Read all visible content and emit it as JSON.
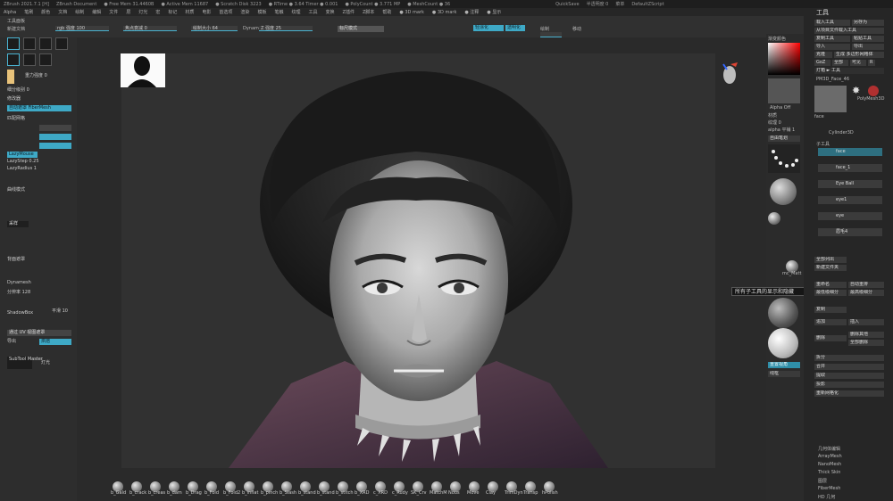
{
  "title_bar": {
    "items": [
      "ZBrush 2021.7.1 [H]",
      "ZBrush Document",
      "● Free Mem 31.4460B",
      "● Active Mem 11687",
      "● Scratch Disk 3223",
      "● RTime ● 3.64 Timer ● 0.001",
      "● PolyCount ● 3.771 MP",
      "● MeshCount ● 36"
    ],
    "quicksave": "QuickSave",
    "transparency": "半透明度 0",
    "menu_label": "菜单",
    "script": "DefaultZScript"
  },
  "menu": [
    "Alpha",
    "笔刷",
    "颜色",
    "文档",
    "绘制",
    "编辑",
    "文件",
    "层",
    "灯光",
    "宏",
    "标记",
    "材质",
    "电影",
    "首选项",
    "渲染",
    "模板",
    "笔触",
    "纹理",
    "工具",
    "变换",
    "Z插件",
    "Z脚本",
    "帮助",
    "● 3D mark",
    "● 3D mark",
    "● 注释",
    "● 显示"
  ],
  "tool_title": "工具",
  "top_shelf": {
    "tool_palette": "工具面板",
    "new_doc": "新建文档",
    "rgb_strength": "rgb 强度 100",
    "z_strength": "Z 强度 25",
    "draw_size": "绘制大小 64",
    "focal": "焦点衰减 0",
    "zadd": "Zadd",
    "zsub": "Zsub",
    "mrgb": "Mrgb",
    "rgb": "Rgb",
    "m": "M",
    "dynamic": "Dynamic",
    "ruler": "标尺模式",
    "btn_a": "轻涂化",
    "btn_b": "透明化",
    "draw": "绘制",
    "move": "移动",
    "scale": "缩放",
    "rotate": "旋转",
    "stroke": "自由笔划",
    "spotlight": "投影球",
    "perspective": "透视",
    "local": "轴",
    "grid": "平移视图"
  },
  "left_panel": {
    "lines": [
      "重力强度 0",
      "细分级别 0",
      "修改器",
      "匹配网格",
      "曲线模式",
      "LazyMouse",
      "LazyStep 0.25",
      "LazyRadius 1",
      "采样",
      "背面遮罩",
      "Dynamesh",
      "ShadowBox",
      "通过 UV 视图遮罩"
    ],
    "btn_seg": "自动遮罩 FiberMesh",
    "btn_curve": "曲线模式",
    "btn_lazy": "LazyMouse",
    "btn_uv": "通过 UV 视图遮罩",
    "btn_xport": "导出",
    "btn_bake": "烘焙",
    "btn_frame": "分辨率 128",
    "btn_smooth": "平滑 10",
    "subtool_master": "SubTool Master",
    "lights": "灯光"
  },
  "right_side": {
    "color_label": "渐变颜色",
    "alpha_off": "Alpha Off",
    "texture_off": "纹理 Off",
    "material": "材质",
    "texture_label": "纹理 0",
    "alpha_label": "alpha 平铺 1",
    "brush_label": "自由笔划",
    "mat_name": "mc_Matt",
    "flat_label": "Flat",
    "shade_label": "SkinShade4",
    "basic_label": "BasicMat",
    "reset": "重置视角",
    "polyframe": "线框"
  },
  "tool_panel": {
    "buttons": [
      "载入工具",
      "另存为",
      "从项目文件载入工具",
      "复制工具",
      "粘贴工具",
      "导入",
      "导出",
      "克隆",
      "生成 多边形网格体",
      "GoZ",
      "全部",
      "可见",
      "R"
    ],
    "lightbox": "灯箱 ► 工具",
    "pm3d": "PM3D_Face_46",
    "tools": [
      "face",
      "Cylinder3D",
      "PolyMesh3D",
      "SimpleBrush"
    ],
    "subtool_header": "子工具",
    "subtools": [
      "face",
      "face_1",
      "Eye Ball",
      "eye1",
      "eye",
      "眉毛4"
    ],
    "list_all": "全部列出",
    "new_folder": "新建文件夹",
    "rename": "重命名",
    "auto_reorder": "自动重排",
    "all_low": "最低级细分",
    "all_high": "最高级细分",
    "dup": "复制",
    "append": "追加",
    "insert": "插入",
    "delete": "删除",
    "del_other": "删除其他",
    "del_all": "全部删除",
    "split": "拆分",
    "merge": "合并",
    "extract": "提取",
    "project": "投影",
    "remesh": "重新网格化",
    "extra": [
      "几何体编辑",
      "ArrayMesh",
      "NanoMesh",
      "Thick Skin",
      "图层",
      "FiberMesh",
      "HD 几何"
    ]
  },
  "tooltip": "所有子工具的显示和隐藏",
  "brushes": [
    "b_Gald",
    "b_crack",
    "b_creas",
    "b_dam",
    "b_Drag",
    "b_Fold",
    "b_Fold2",
    "b_inflat",
    "b_pinch",
    "b_Slash",
    "b_stand",
    "b_stand",
    "b_stitch",
    "b_XRD",
    "c_XRD",
    "c_Rudy",
    "SK_Crv",
    "MatchM",
    "Nous",
    "Move",
    "Clay",
    "TrimDyn",
    "Transp",
    "hPolish"
  ],
  "colors": {
    "accent": "#3ea9c6",
    "bg": "#2b2b2b"
  }
}
